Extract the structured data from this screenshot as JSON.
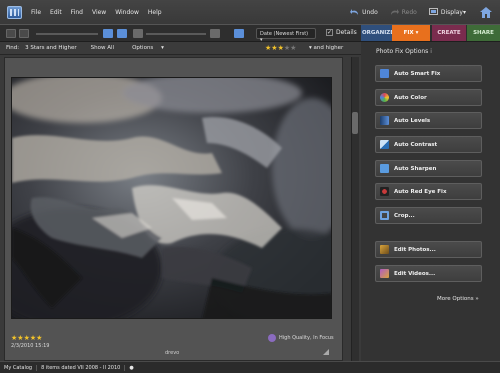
{
  "menubar": {
    "items": [
      "File",
      "Edit",
      "Find",
      "View",
      "Window",
      "Help"
    ],
    "undo_label": "Undo",
    "redo_label": "Redo",
    "display_label": "Display"
  },
  "toolbar": {
    "sort_label": "Date (Newest First)",
    "details_label": "Details"
  },
  "tabs": {
    "organize": "ORGANIZE",
    "fix": "FIX",
    "create": "CREATE",
    "share": "SHARE"
  },
  "findbar": {
    "find_label": "Find:",
    "filter_label": "3 Stars and Higher",
    "show_all_label": "Show All",
    "options_label": "Options",
    "and_higher_label": "and higher",
    "star_count": 3
  },
  "photo": {
    "rating_stars": 5,
    "date": "2/3/2010 15:19",
    "quality_label": "High Quality, In Focus",
    "caption": "drevo"
  },
  "fix_panel": {
    "title": "Photo Fix Options",
    "buttons": [
      {
        "label": "Auto Smart Fix",
        "icon": "smart-fix-icon",
        "color": "#4f86d8"
      },
      {
        "label": "Auto Color",
        "icon": "color-wheel-icon",
        "color": "#d8455a"
      },
      {
        "label": "Auto Levels",
        "icon": "levels-icon",
        "color": "#5b8fd9"
      },
      {
        "label": "Auto Contrast",
        "icon": "contrast-icon",
        "color": "#4aa0dd"
      },
      {
        "label": "Auto Sharpen",
        "icon": "sharpen-icon",
        "color": "#5a9bdf"
      },
      {
        "label": "Auto Red Eye Fix",
        "icon": "red-eye-icon",
        "color": "#c93a3a"
      },
      {
        "label": "Crop...",
        "icon": "crop-icon",
        "color": "#6fa3e0"
      },
      {
        "label": "Edit Photos...",
        "icon": "edit-photos-icon",
        "color": "#d9a43c"
      },
      {
        "label": "Edit Videos...",
        "icon": "edit-videos-icon",
        "color": "#b05cc4"
      }
    ],
    "more_options_label": "More Options"
  },
  "statusbar": {
    "catalog_label": "My Catalog",
    "items_label": "8 items dated VII 2008 - II 2010"
  },
  "colors": {
    "accent_fix": "#e8701d",
    "organize": "#2f4f7c",
    "create": "#7a2c4e",
    "share": "#3e6b38",
    "star": "#f1c22a"
  }
}
